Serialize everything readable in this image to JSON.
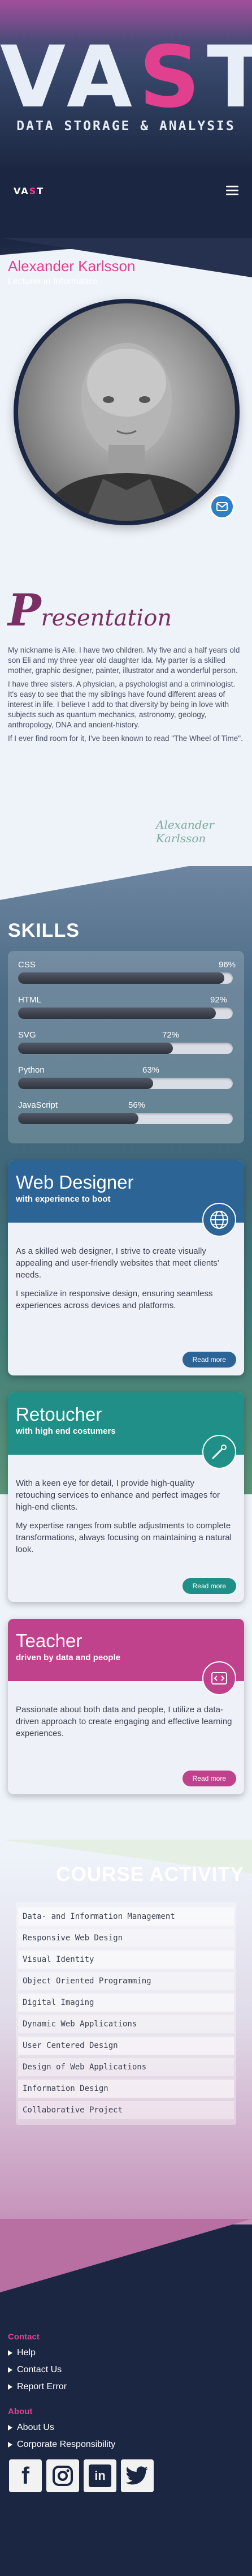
{
  "brand": {
    "logo_part1": "VA",
    "logo_accent": "S",
    "logo_part2": "T",
    "tagline": "DATA STORAGE & ANALYSIS"
  },
  "nav": {
    "logo_part1": "VA",
    "logo_accent": "S",
    "logo_part2": "T",
    "menu_icon": "hamburger-icon"
  },
  "profile": {
    "name": "Alexander Karlsson",
    "role": "Lecturer in Informatics",
    "contact_icon": "mail-icon"
  },
  "presentation": {
    "title_initial": "P",
    "title_rest": "resentation",
    "paragraphs": [
      "My nickname is Alle. I have two children. My five and a half years old son Eli and my three year old daughter Ida. My parter is a skilled mother, graphic designer, painter, illustrator and a wonderful person.",
      "I have three sisters. A physician, a psychologist and a criminologist. It's easy to see that the my siblings have found different areas of interest in life. I believe I add to that diversity by being in love with subjects such as quantum mechanics, astronomy, geology, anthropology, DNA and ancient-history.",
      "If I ever find room for it, I've been known to read \"The Wheel of Time\"."
    ],
    "signature": "Alexander Karlsson"
  },
  "skills": {
    "heading": "SKILLS",
    "items": [
      {
        "name": "CSS",
        "pct_label": "96%",
        "value": 96
      },
      {
        "name": "HTML",
        "pct_label": "92%",
        "value": 92
      },
      {
        "name": "SVG",
        "pct_label": "72%",
        "value": 72
      },
      {
        "name": "Python",
        "pct_label": "63%",
        "value": 63
      },
      {
        "name": "JavaScript",
        "pct_label": "56%",
        "value": 56
      }
    ]
  },
  "cards": [
    {
      "title": "Web Designer",
      "subtitle": "with experience to boot",
      "icon": "globe-icon",
      "paragraphs": [
        "As a skilled web designer, I strive to create visually appealing and user-friendly websites that meet clients' needs.",
        "I specialize in responsive design, ensuring seamless experiences across devices and platforms."
      ],
      "button": "Read more",
      "color": "#2d6496"
    },
    {
      "title": "Retoucher",
      "subtitle": "with high end costumers",
      "icon": "magic-wand-icon",
      "paragraphs": [
        "With a keen eye for detail, I provide high-quality retouching services to enhance and perfect images for high-end clients.",
        "My expertise ranges from subtle adjustments to complete transformations, always focusing on maintaining a natural look."
      ],
      "button": "Read more",
      "color": "#1f8f87"
    },
    {
      "title": "Teacher",
      "subtitle": "driven by data and people",
      "icon": "code-icon",
      "paragraphs": [
        "Passionate about both data and people, I utilize a data-driven approach to create engaging and effective learning experiences."
      ],
      "button": "Read more",
      "color": "#c0418c"
    }
  ],
  "courses": {
    "heading": "COURSE ACTIVITY",
    "items": [
      "Data- and Information Management",
      "Responsive Web Design",
      "Visual Identity",
      "Object Oriented Programming",
      "Digital Imaging",
      "Dynamic Web Applications",
      "User Centered Design",
      "Design of Web Applications",
      "Information Design",
      "Collaborative Project"
    ]
  },
  "footer": {
    "contact_heading": "Contact",
    "contact_links": [
      "Help",
      "Contact Us",
      "Report Error"
    ],
    "about_heading": "About",
    "about_links": [
      "About Us",
      "Corporate Responsibility"
    ],
    "social": [
      {
        "icon": "facebook-icon",
        "label": "f"
      },
      {
        "icon": "instagram-icon",
        "label": ""
      },
      {
        "icon": "linkedin-icon",
        "label": "in"
      },
      {
        "icon": "twitter-icon",
        "label": ""
      }
    ]
  },
  "colors": {
    "accent": "#e0408e",
    "navy": "#1b2742"
  }
}
